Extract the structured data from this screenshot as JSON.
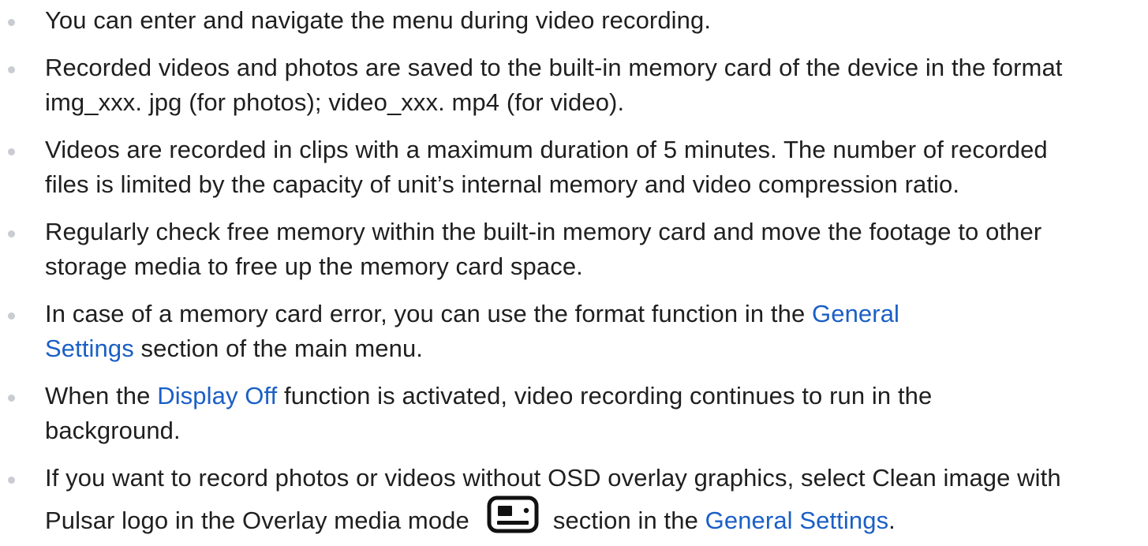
{
  "bullets": [
    {
      "lines": [
        [
          "You can enter and navigate the menu during video recording."
        ]
      ]
    },
    {
      "lines": [
        [
          "Recorded videos and photos are saved to the built-in memory card of the device in the format"
        ],
        [
          "img_xxx. jpg (for photos); video_xxx. mp4 (for video)."
        ]
      ]
    },
    {
      "lines": [
        [
          "Videos are recorded in clips with a maximum duration of 5 minutes. The number of recorded"
        ],
        [
          "files is limited by the capacity of unit’s internal memory and video compression ratio."
        ]
      ]
    },
    {
      "lines": [
        [
          "Regularly check free memory within the built-in memory card and move the footage to other"
        ],
        [
          "storage media to free up the memory card space."
        ]
      ]
    },
    {
      "line1_text": "In case of a memory card error, you can use the format function in the ",
      "link_part1": "General",
      "link_part2": "Settings",
      "line2_rest": " section of the main menu."
    },
    {
      "line1_pre": "When the ",
      "link": "Display Off",
      "line1_post": " function is activated, video recording continues to run in the",
      "line2": "background."
    },
    {
      "line1": "If you want to record photos or videos without OSD overlay graphics, select Clean image with",
      "line2_pre": "Pulsar logo in the Overlay media mode",
      "icon": "overlay-media-mode-icon",
      "line2_mid": "section in the ",
      "link": "General Settings",
      "line2_post": "."
    }
  ],
  "colors": {
    "text": "#1f1f1f",
    "link": "#1a5fc6",
    "bullet": "#c9ccd1"
  }
}
